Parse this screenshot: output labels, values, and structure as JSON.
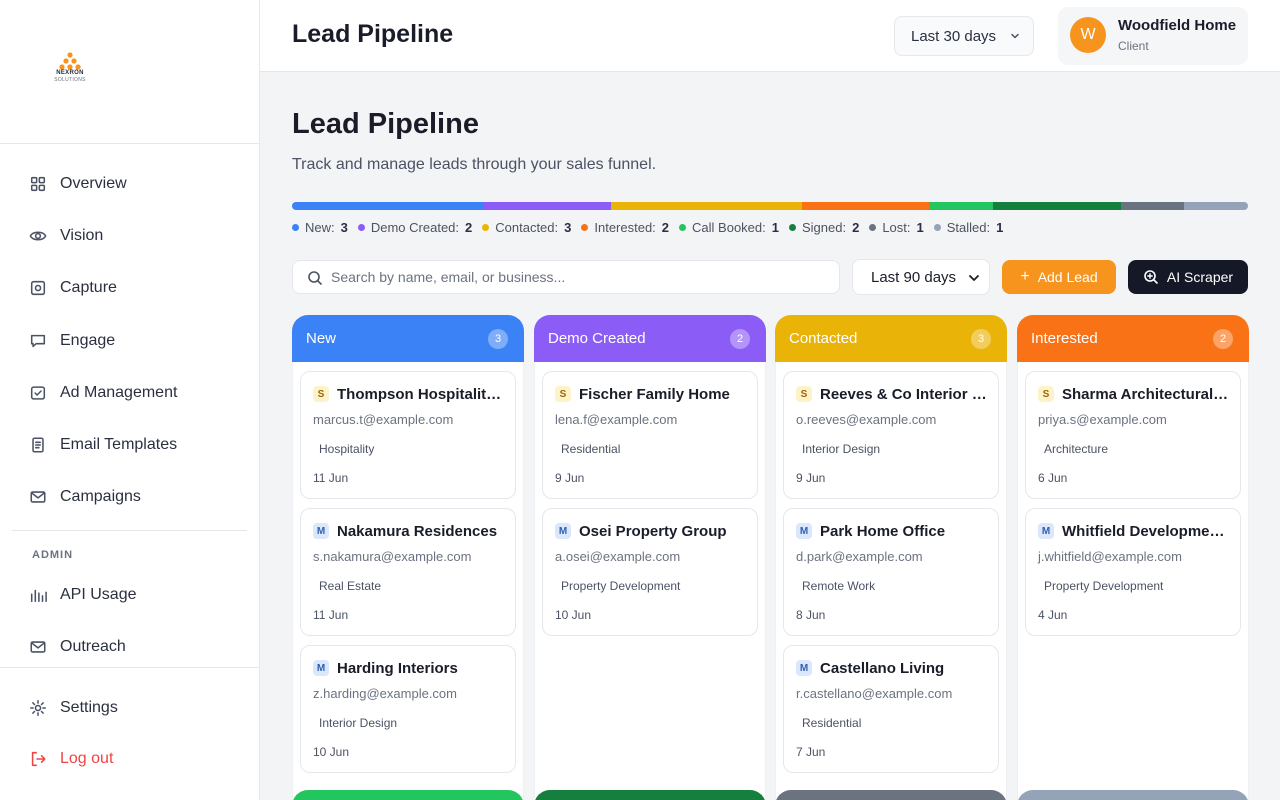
{
  "app": {
    "logo_line1": "NEXRON",
    "logo_line2": "SOLUTIONS"
  },
  "sidebar": {
    "items": [
      {
        "label": "Overview",
        "icon": "grid-icon"
      },
      {
        "label": "Vision",
        "icon": "eye-icon"
      },
      {
        "label": "Capture",
        "icon": "capture-icon"
      },
      {
        "label": "Engage",
        "icon": "chat-icon"
      },
      {
        "label": "Ad Management",
        "icon": "checkbox-icon"
      },
      {
        "label": "Email Templates",
        "icon": "document-icon"
      },
      {
        "label": "Campaigns",
        "icon": "mail-icon"
      }
    ],
    "admin_label": "ADMIN",
    "admin_items": [
      {
        "label": "API Usage",
        "icon": "bar-chart-icon"
      },
      {
        "label": "Outreach",
        "icon": "mail-icon"
      }
    ],
    "settings_label": "Settings",
    "logout_label": "Log out"
  },
  "header": {
    "title": "Lead Pipeline",
    "range_label": "Last 30 days",
    "user": {
      "initial": "W",
      "name": "Woodfield Home",
      "role": "Client"
    }
  },
  "main": {
    "title": "Lead Pipeline",
    "subtitle": "Track and manage leads through your sales funnel.",
    "funnel": [
      {
        "label": "New:",
        "count": 3,
        "color": "#3b82f6"
      },
      {
        "label": "Demo Created:",
        "count": 2,
        "color": "#8b5cf6"
      },
      {
        "label": "Contacted:",
        "count": 3,
        "color": "#eab308"
      },
      {
        "label": "Interested:",
        "count": 2,
        "color": "#f97316"
      },
      {
        "label": "Call Booked:",
        "count": 1,
        "color": "#22c55e"
      },
      {
        "label": "Signed:",
        "count": 2,
        "color": "#15803d"
      },
      {
        "label": "Lost:",
        "count": 1,
        "color": "#6b7280"
      },
      {
        "label": "Stalled:",
        "count": 1,
        "color": "#94a3b8"
      }
    ],
    "search_placeholder": "Search by name, email, or business...",
    "filter_value": "Last 90 days",
    "add_label": "Add Lead",
    "ai_label": "AI Scraper"
  },
  "columns": [
    {
      "title": "New",
      "count": "3",
      "color": "#3b82f6",
      "cards": [
        {
          "tier": "S",
          "name": "Thompson Hospitality Group",
          "email": "marcus.t@example.com",
          "tag": "Hospitality",
          "date": "11 Jun"
        },
        {
          "tier": "M",
          "name": "Nakamura Residences",
          "email": "s.nakamura@example.com",
          "tag": "Real Estate",
          "date": "11 Jun"
        },
        {
          "tier": "M",
          "name": "Harding Interiors",
          "email": "z.harding@example.com",
          "tag": "Interior Design",
          "date": "10 Jun"
        }
      ]
    },
    {
      "title": "Demo Created",
      "count": "2",
      "color": "#8b5cf6",
      "cards": [
        {
          "tier": "S",
          "name": "Fischer Family Home",
          "email": "lena.f@example.com",
          "tag": "Residential",
          "date": "9 Jun"
        },
        {
          "tier": "M",
          "name": "Osei Property Group",
          "email": "a.osei@example.com",
          "tag": "Property Development",
          "date": "10 Jun"
        }
      ]
    },
    {
      "title": "Contacted",
      "count": "3",
      "color": "#eab308",
      "cards": [
        {
          "tier": "S",
          "name": "Reeves & Co Interior Design",
          "email": "o.reeves@example.com",
          "tag": "Interior Design",
          "date": "9 Jun"
        },
        {
          "tier": "M",
          "name": "Park Home Office",
          "email": "d.park@example.com",
          "tag": "Remote Work",
          "date": "8 Jun"
        },
        {
          "tier": "M",
          "name": "Castellano Living",
          "email": "r.castellano@example.com",
          "tag": "Residential",
          "date": "7 Jun"
        }
      ]
    },
    {
      "title": "Interested",
      "count": "2",
      "color": "#f97316",
      "cards": [
        {
          "tier": "S",
          "name": "Sharma Architectural Studio",
          "email": "priya.s@example.com",
          "tag": "Architecture",
          "date": "6 Jun"
        },
        {
          "tier": "M",
          "name": "Whitfield Developments",
          "email": "j.whitfield@example.com",
          "tag": "Property Development",
          "date": "4 Jun"
        }
      ]
    }
  ],
  "next_columns_colors": [
    "#22c55e",
    "#15803d",
    "#6b7280",
    "#94a3b8"
  ]
}
